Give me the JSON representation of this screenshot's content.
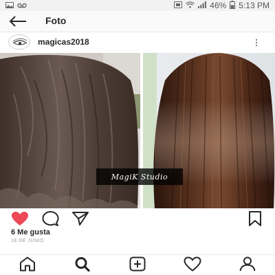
{
  "status_bar": {
    "battery_percent": "46%",
    "time": "5:13 PM",
    "left_icons": [
      "gallery-icon",
      "voicemail-icon"
    ],
    "right_icons": [
      "cast-icon",
      "wifi-icon",
      "signal-icon"
    ]
  },
  "header": {
    "title": "Foto",
    "back_icon": "arrow-left-icon"
  },
  "post": {
    "username": "magicas2018",
    "watermark": "MagiK Studio",
    "likes": "6 Me gusta",
    "date": "18 DE JUNIO",
    "actions": [
      "heart-filled-icon",
      "comment-icon",
      "share-icon",
      "bookmark-icon"
    ]
  },
  "bottom_nav": [
    "home-icon",
    "search-icon",
    "add-icon",
    "activity-icon",
    "profile-icon"
  ],
  "colors": {
    "like_red": "#ed4956",
    "text": "#262626",
    "muted": "#999999",
    "hair_before": "#4a3a30",
    "hair_after": "#3a2117"
  }
}
